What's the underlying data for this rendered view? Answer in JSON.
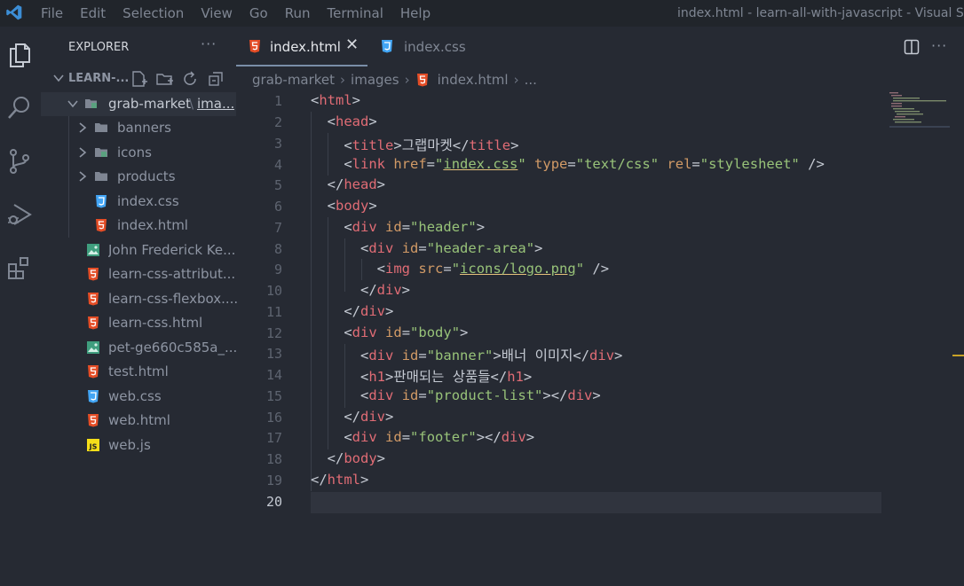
{
  "menu": [
    "File",
    "Edit",
    "Selection",
    "View",
    "Go",
    "Run",
    "Terminal",
    "Help"
  ],
  "window_title": "index.html - learn-all-with-javascript - Visual Studi",
  "sidebar": {
    "header": "EXPLORER",
    "more": "···",
    "root_label": "LEARN-...",
    "tree": [
      {
        "name": "grab-market",
        "path_suffix": "ima...",
        "kind": "folder-open-special"
      },
      {
        "name": "banners",
        "kind": "folder"
      },
      {
        "name": "icons",
        "kind": "folder-special"
      },
      {
        "name": "products",
        "kind": "folder"
      },
      {
        "name": "index.css",
        "kind": "css"
      },
      {
        "name": "index.html",
        "kind": "html"
      },
      {
        "name": "John Frederick Ke...",
        "kind": "image"
      },
      {
        "name": "learn-css-attribut...",
        "kind": "html"
      },
      {
        "name": "learn-css-flexbox....",
        "kind": "html"
      },
      {
        "name": "learn-css.html",
        "kind": "html"
      },
      {
        "name": "pet-ge660c585a_...",
        "kind": "image"
      },
      {
        "name": "test.html",
        "kind": "html"
      },
      {
        "name": "web.css",
        "kind": "css"
      },
      {
        "name": "web.html",
        "kind": "html"
      },
      {
        "name": "web.js",
        "kind": "js"
      }
    ]
  },
  "tabs": [
    {
      "label": "index.html",
      "active": true,
      "close": "✕"
    },
    {
      "label": "index.css",
      "active": false
    }
  ],
  "tab_more": "···",
  "breadcrumb": [
    "grab-market",
    "images",
    "index.html",
    "..."
  ],
  "editor": {
    "line_numbers": [
      "1",
      "2",
      "3",
      "4",
      "5",
      "6",
      "7",
      "8",
      "9",
      "10",
      "11",
      "12",
      "13",
      "14",
      "15",
      "16",
      "17",
      "18",
      "19",
      "20"
    ],
    "current_line": "20",
    "title_text": "그랩마켓",
    "link_href": "index.css",
    "link_type": "text/css",
    "link_rel": "stylesheet",
    "img_src": "icons/logo.png",
    "banner_text": "배너 이미지",
    "h1_text": "판매되는 상품들",
    "ids": {
      "header": "header",
      "header_area": "header-area",
      "body": "body",
      "banner": "banner",
      "product_list": "product-list",
      "footer": "footer"
    }
  },
  "colors": {
    "background": "#262a33",
    "tag": "#e06c75",
    "attribute": "#d19a66",
    "string": "#98c379",
    "html_icon": "#e44d26",
    "css_icon": "#42a5f5",
    "js_icon": "#f5de19"
  }
}
